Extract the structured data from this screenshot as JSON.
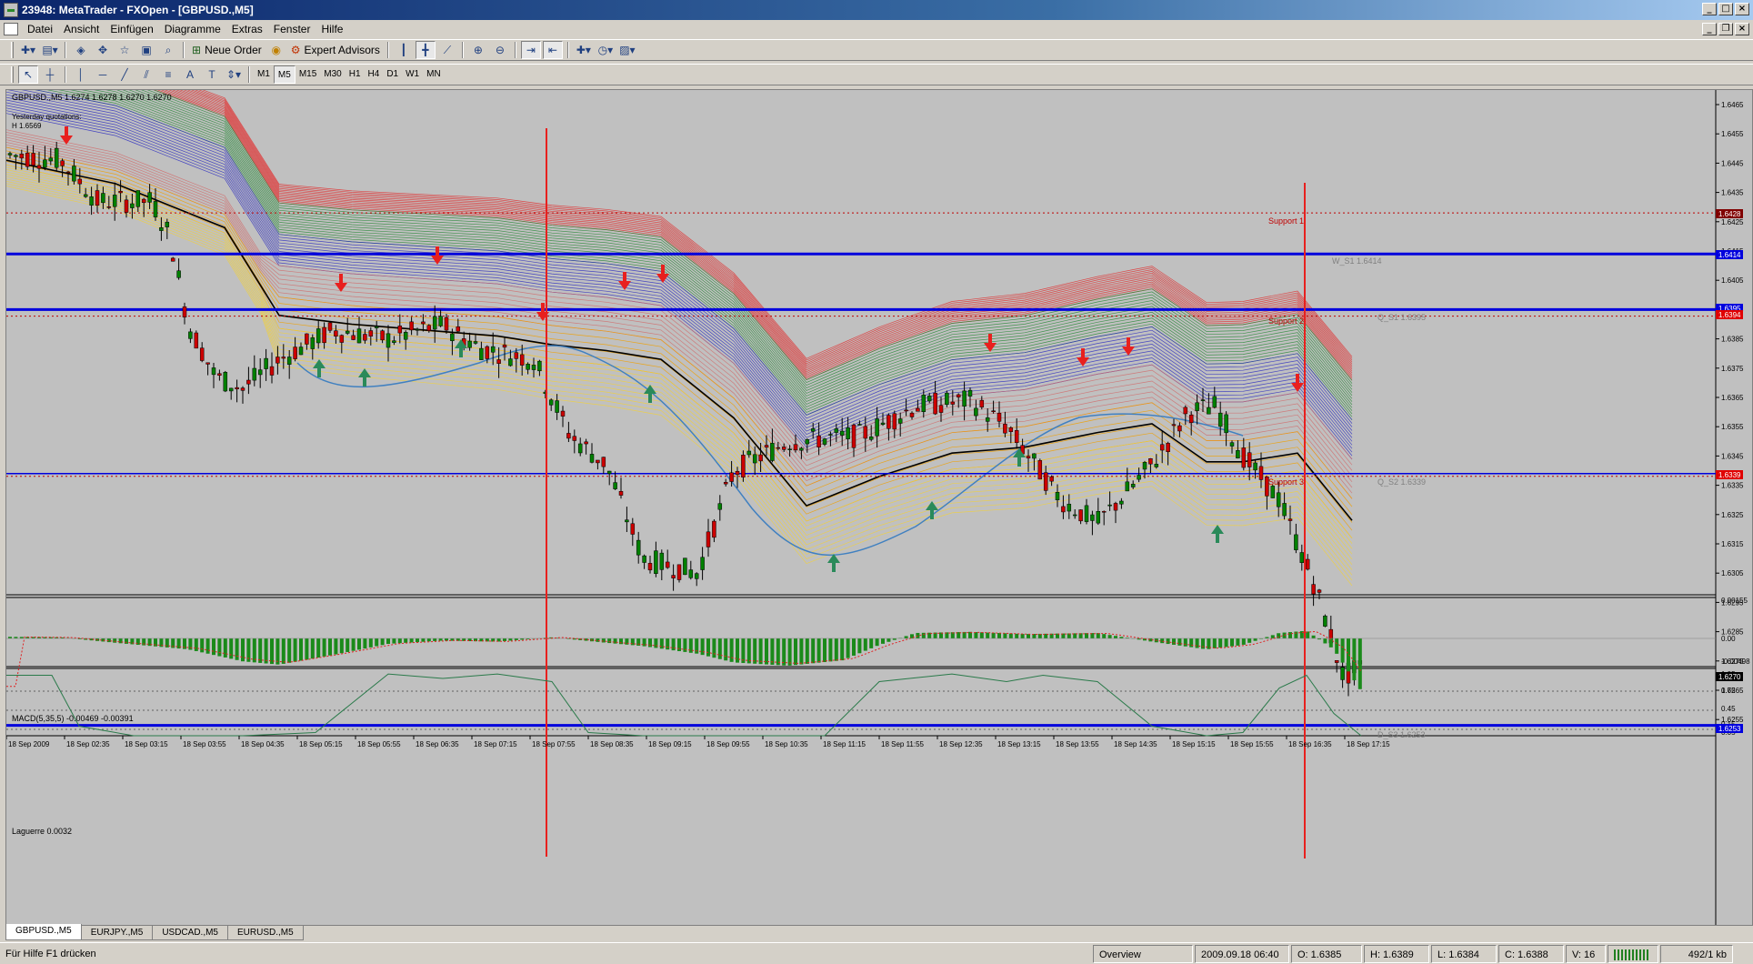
{
  "window": {
    "title": "23948: MetaTrader - FXOpen - [GBPUSD.,M5]"
  },
  "menu": [
    "Datei",
    "Ansicht",
    "Einfügen",
    "Diagramme",
    "Extras",
    "Fenster",
    "Hilfe"
  ],
  "toolbar": {
    "new_order": "Neue Order",
    "expert_advisors": "Expert Advisors"
  },
  "timeframes": [
    "M1",
    "M5",
    "M15",
    "M30",
    "H1",
    "H4",
    "D1",
    "W1",
    "MN"
  ],
  "active_timeframe": "M5",
  "chart": {
    "symbol_info": "GBPUSD.,M5  1.6274 1.6278 1.6270 1.6270",
    "yesterday_label": "Yesterday quotations:",
    "yesterday_high": "H 1.6569",
    "price_ticks": [
      "1.6465",
      "1.6455",
      "1.6445",
      "1.6435",
      "1.6425",
      "1.6415",
      "1.6405",
      "1.6395",
      "1.6385",
      "1.6375",
      "1.6365",
      "1.6355",
      "1.6345",
      "1.6335",
      "1.6325",
      "1.6315",
      "1.6305",
      "1.6295",
      "1.6285",
      "1.6275",
      "1.6265",
      "1.6255"
    ],
    "time_ticks": [
      "18 Sep 2009",
      "18 Sep 02:35",
      "18 Sep 03:15",
      "18 Sep 03:55",
      "18 Sep 04:35",
      "18 Sep 05:15",
      "18 Sep 05:55",
      "18 Sep 06:35",
      "18 Sep 07:15",
      "18 Sep 07:55",
      "18 Sep 08:35",
      "18 Sep 09:15",
      "18 Sep 09:55",
      "18 Sep 10:35",
      "18 Sep 11:15",
      "18 Sep 11:55",
      "18 Sep 12:35",
      "18 Sep 13:15",
      "18 Sep 13:55",
      "18 Sep 14:35",
      "18 Sep 15:15",
      "18 Sep 15:55",
      "18 Sep 16:35",
      "18 Sep 17:15"
    ],
    "price_tags": {
      "support1": "1.6428",
      "w_s1": "1.6414",
      "q_s1": "1.6395",
      "support2": "1.6394",
      "support3": "1.6339",
      "current": "1.6270",
      "d_s3": "1.6253"
    },
    "labels": {
      "support1": "Support 1",
      "w_s1": "W_S1 1.6414",
      "q_s1": "Q_S1 1.6395",
      "support2": "Support 2",
      "q_s2": "Q_S2 1.6339",
      "support3": "Support 3",
      "d_s3": "D_S3 1.6253"
    },
    "macd_label": "MACD(5,35,5) -0.00469 -0.00391",
    "macd_ticks": [
      "0.00155",
      "0.00",
      "-0.00498"
    ],
    "laguerre_label": "Laguerre 0.0032",
    "laguerre_ticks": [
      "1.05",
      "0.75",
      "0.45",
      "0.15",
      "0.05"
    ]
  },
  "tabs": [
    "GBPUSD.,M5",
    "EURJPY.,M5",
    "USDCAD.,M5",
    "EURUSD.,M5"
  ],
  "status": {
    "help": "Für Hilfe F1 drücken",
    "profile": "Overview",
    "datetime": "2009.09.18 06:40",
    "open": "O: 1.6385",
    "high": "H: 1.6389",
    "low": "L: 1.6384",
    "close": "C: 1.6388",
    "volume": "V: 16",
    "traffic": "492/1 kb"
  },
  "colors": {
    "bg": "#c0c0c0",
    "bull": "#008000",
    "bear": "#cc0000",
    "level": "#0000dd",
    "marker": "#e8201e"
  }
}
